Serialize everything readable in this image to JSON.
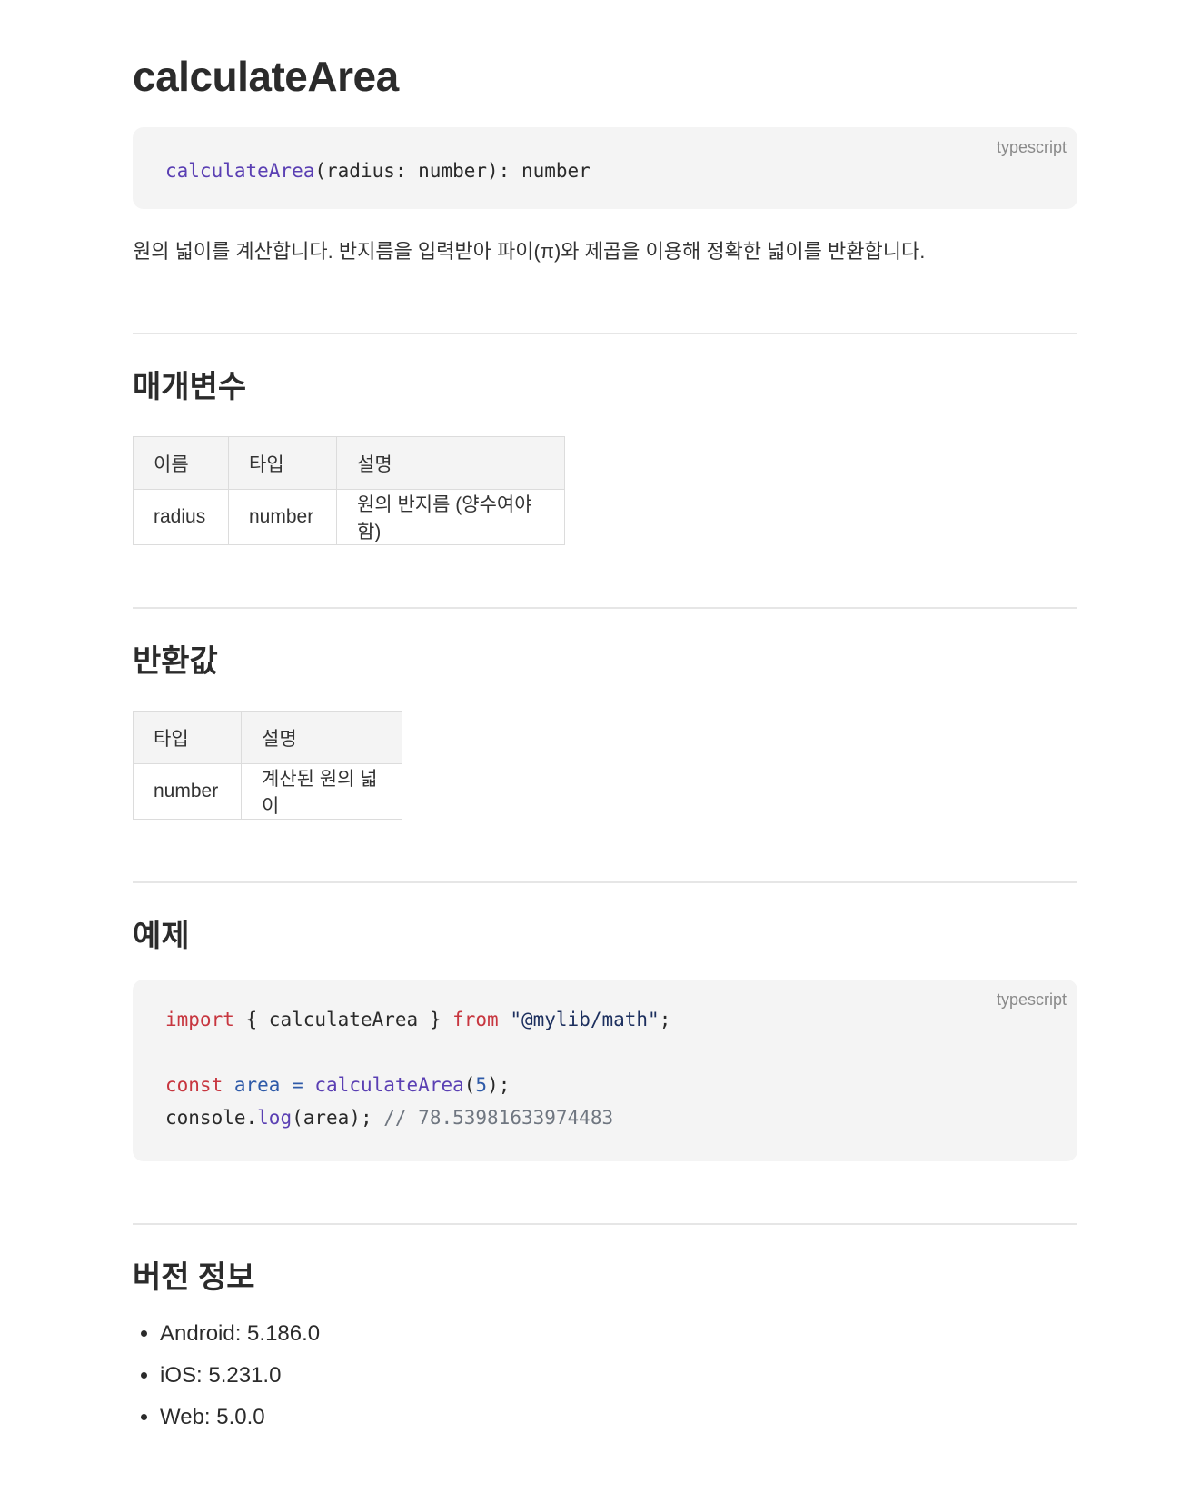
{
  "title": "calculateArea",
  "signature": {
    "lang": "typescript",
    "fn": "calculateArea",
    "rest": "(radius: number): number"
  },
  "description": "원의 넓이를 계산합니다. 반지름을 입력받아 파이(π)와 제곱을 이용해 정확한 넓이를 반환합니다.",
  "params": {
    "heading": "매개변수",
    "columns": [
      "이름",
      "타입",
      "설명"
    ],
    "rows": [
      [
        "radius",
        "number",
        "원의 반지름 (양수여야 함)"
      ]
    ]
  },
  "returns": {
    "heading": "반환값",
    "columns": [
      "타입",
      "설명"
    ],
    "rows": [
      [
        "number",
        "계산된 원의 넓이"
      ]
    ]
  },
  "example": {
    "heading": "예제",
    "lang": "typescript",
    "line1": {
      "kw_import": "import",
      "braces_open": " { ",
      "name": "calculateArea",
      "braces_close": " } ",
      "kw_from": "from",
      "space": " ",
      "str": "\"@mylib/math\"",
      "semi": ";"
    },
    "line3": {
      "kw_const": "const",
      "space1": " ",
      "var": "area",
      "eq": " = ",
      "fn": "calculateArea",
      "open": "(",
      "num": "5",
      "close": ");"
    },
    "line4": {
      "obj": "console.",
      "fn": "log",
      "args": "(area); ",
      "comment": "// 78.53981633974483"
    }
  },
  "versions": {
    "heading": "버전 정보",
    "items": [
      "Android: 5.186.0",
      "iOS: 5.231.0",
      "Web: 5.0.0"
    ]
  }
}
